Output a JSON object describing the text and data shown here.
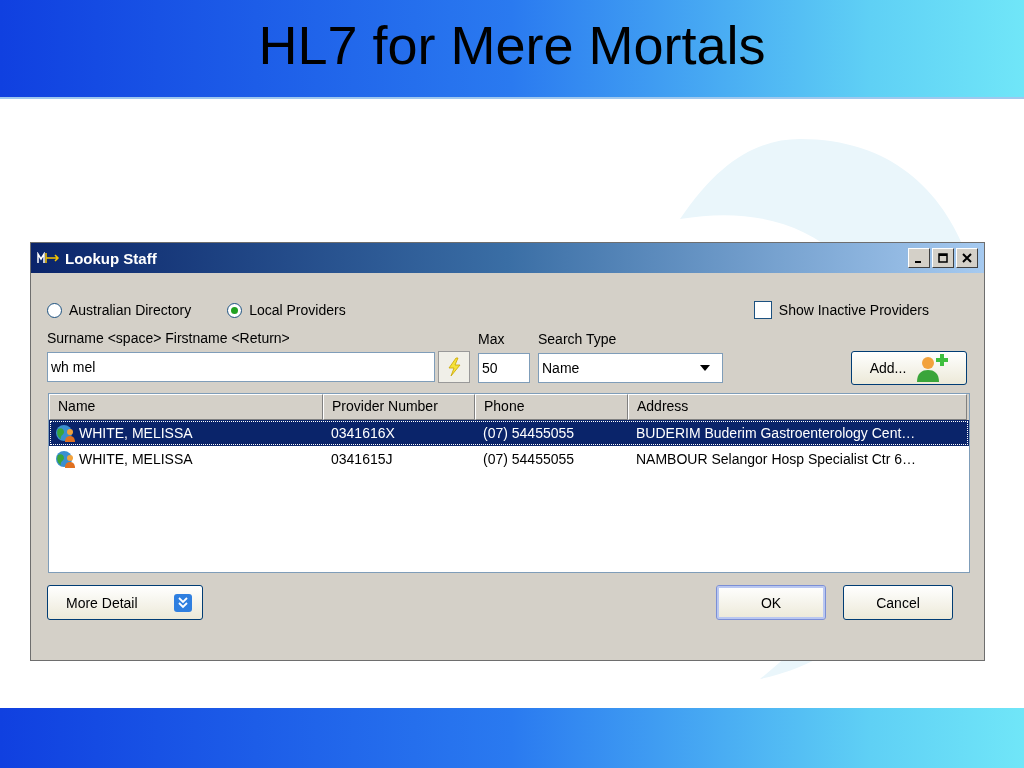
{
  "slide": {
    "title": "HL7 for Mere Mortals"
  },
  "window": {
    "title": "Lookup Staff"
  },
  "source_options": [
    {
      "label": "Australian Directory",
      "selected": false
    },
    {
      "label": "Local Providers",
      "selected": true
    }
  ],
  "show_inactive": {
    "label": "Show Inactive Providers",
    "checked": false
  },
  "search": {
    "label": "Surname <space> Firstname <Return>",
    "value": "wh mel"
  },
  "max": {
    "label": "Max",
    "value": "50"
  },
  "search_type": {
    "label": "Search Type",
    "value": "Name"
  },
  "add_button": {
    "label": "Add..."
  },
  "table": {
    "columns": [
      "Name",
      "Provider Number",
      "Phone",
      "Address"
    ],
    "rows": [
      {
        "selected": true,
        "cells": [
          "WHITE, MELISSA",
          "0341616X",
          "(07) 54455055",
          "BUDERIM Buderim Gastroenterology Cent…"
        ]
      },
      {
        "selected": false,
        "cells": [
          "WHITE, MELISSA",
          "0341615J",
          "(07) 54455055",
          "NAMBOUR Selangor Hosp Specialist Ctr 6…"
        ]
      }
    ]
  },
  "more_detail_button": {
    "label": "More Detail"
  },
  "ok_button": {
    "label": "OK",
    "focused": true
  },
  "cancel_button": {
    "label": "Cancel",
    "focused": false
  }
}
